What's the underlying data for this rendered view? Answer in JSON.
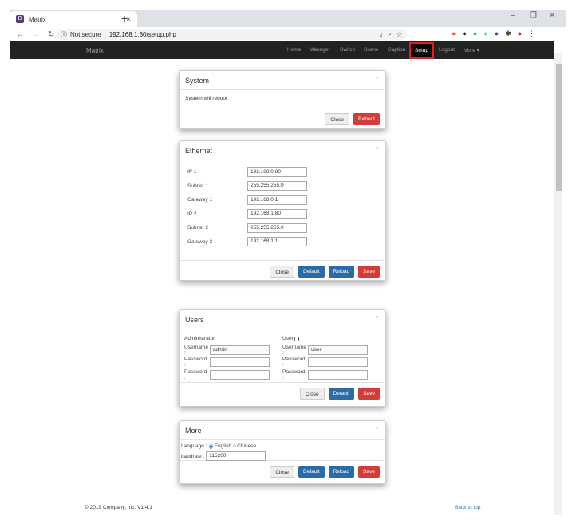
{
  "browser": {
    "tab_title": "Matrix",
    "favicon": "B",
    "url_security": "Not secure",
    "url": "192.168.1.80/setup.php"
  },
  "navbar": {
    "brand": "Matrix",
    "items": [
      "Home",
      "Manager",
      "Switch",
      "Scene",
      "Caption",
      "Setup",
      "Logout",
      "More ▾"
    ],
    "active": "Setup"
  },
  "system": {
    "title": "System",
    "message": "System will reboot",
    "close": "Close",
    "reboot": "Reboot"
  },
  "ethernet": {
    "title": "Ethernet",
    "fields": [
      {
        "label": "IP 1",
        "value": "192.168.0.80"
      },
      {
        "label": "Subnet 1",
        "value": "255.255.255.0"
      },
      {
        "label": "Gateway 1",
        "value": "192.168.0.1"
      },
      {
        "label": "IP 2",
        "value": "192.168.1.80"
      },
      {
        "label": "Subnet 2",
        "value": "255.255.255.0"
      },
      {
        "label": "Gateway 2",
        "value": "192.168.1.1"
      }
    ],
    "close": "Close",
    "default": "Default",
    "reload": "Reload",
    "save": "Save"
  },
  "users": {
    "title": "Users",
    "admin_label": "Administrator",
    "user_label": "User",
    "username_label": "Username :",
    "password_label": "Password :",
    "admin_username": "admin",
    "user_username": "user",
    "close": "Close",
    "default": "Default",
    "save": "Save"
  },
  "more": {
    "title": "More",
    "language_label": "Language :",
    "english": "English",
    "chinese": "Chinese",
    "baudrate_label": "baudrate :",
    "baudrate": "115200",
    "close": "Close",
    "default": "Default",
    "reload": "Reload",
    "save": "Save"
  },
  "footer": {
    "copyright": "© 2019 Company, Inc. V1.4.1",
    "back_to_top": "Back to top"
  },
  "close_glyph": "×"
}
